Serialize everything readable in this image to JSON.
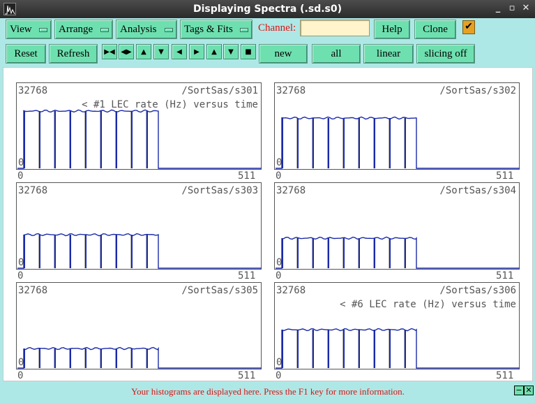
{
  "window": {
    "title": "Displaying Spectra (.sd.s0)"
  },
  "toolbar": {
    "menus": [
      "View",
      "Arrange",
      "Analysis",
      "Tags & Fits"
    ],
    "channel_label": "Channel:",
    "channel_value": "",
    "help": "Help",
    "clone": "Clone",
    "reset": "Reset",
    "refresh": "Refresh",
    "new": "new",
    "all": "all",
    "linear": "linear",
    "slicing": "slicing off"
  },
  "colors": {
    "trace": "#1a2aa8",
    "accent_red": "#dd1111",
    "button": "#6ee0b0"
  },
  "plots": [
    {
      "ymax": "32768",
      "name": "/SortSas/s301",
      "subtitle": "< #1 LEC rate (Hz) versus time",
      "ymin": "0",
      "xmin": "0",
      "xmax": "511",
      "level": 0.82
    },
    {
      "ymax": "32768",
      "name": "/SortSas/s302",
      "subtitle": "",
      "ymin": "0",
      "xmin": "0",
      "xmax": "511",
      "level": 0.72
    },
    {
      "ymax": "32768",
      "name": "/SortSas/s303",
      "subtitle": "",
      "ymin": "0",
      "xmin": "0",
      "xmax": "511",
      "level": 0.48
    },
    {
      "ymax": "32768",
      "name": "/SortSas/s304",
      "subtitle": "",
      "ymin": "0",
      "xmin": "0",
      "xmax": "511",
      "level": 0.43
    },
    {
      "ymax": "32768",
      "name": "/SortSas/s305",
      "subtitle": "",
      "ymin": "0",
      "xmin": "0",
      "xmax": "511",
      "level": 0.28
    },
    {
      "ymax": "32768",
      "name": "/SortSas/s306",
      "subtitle": "< #6 LEC rate (Hz) versus time",
      "ymin": "0",
      "xmin": "0",
      "xmax": "511",
      "level": 0.55
    }
  ],
  "status": {
    "message": "Your histograms are displayed here. Press the F1 key for more information."
  }
}
